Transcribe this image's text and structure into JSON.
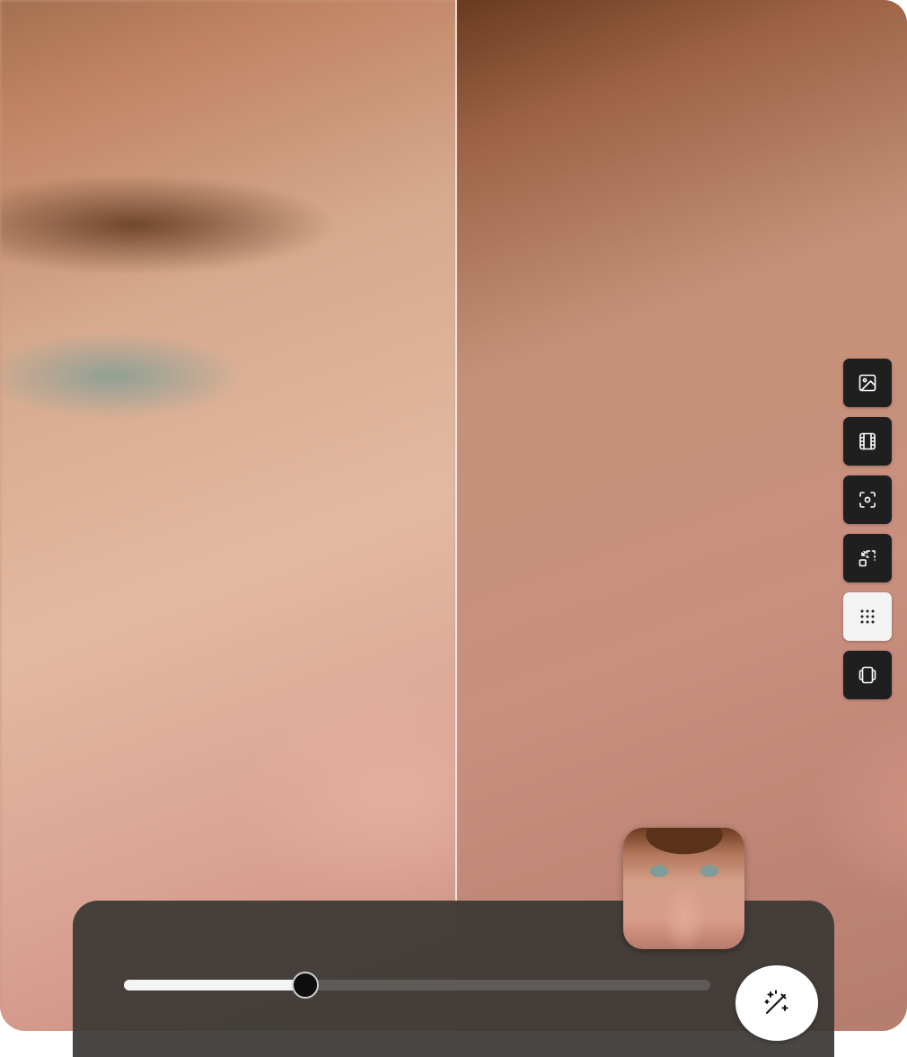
{
  "viewer": {
    "before_image": "portrait-blurry",
    "after_image": "portrait-enhanced",
    "comparison_split": 0.503
  },
  "tool_rail": {
    "items": [
      {
        "icon": "image-icon",
        "active": false
      },
      {
        "icon": "film-icon",
        "active": false
      },
      {
        "icon": "focus-icon",
        "active": false
      },
      {
        "icon": "resize-icon",
        "active": false
      },
      {
        "icon": "grid-dots-icon",
        "active": true
      },
      {
        "icon": "layers-icon",
        "active": false
      }
    ]
  },
  "enhance_panel": {
    "strength_slider": {
      "value": 0.31,
      "min": 0,
      "max": 1
    },
    "action_icon": "magic-wand-icon"
  },
  "thumbnail": {
    "image": "portrait-thumbnail"
  },
  "colors": {
    "tool_bg": "#1f1f1f",
    "tool_active_bg": "#f3f3f3",
    "panel_bg": "#3a3734",
    "slider_fill": "#f4f4f4",
    "slider_track": "#5d5a57"
  }
}
